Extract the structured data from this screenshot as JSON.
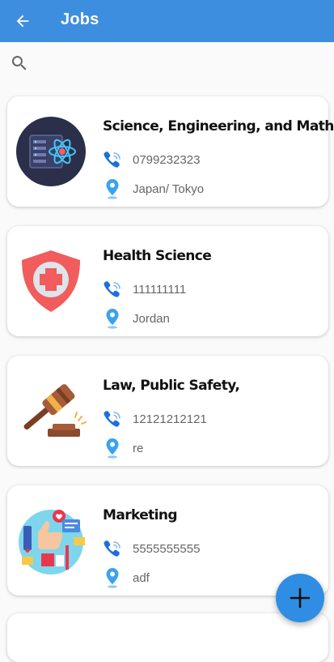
{
  "appbar": {
    "title": "Jobs",
    "back_icon": "arrow-left-icon",
    "color": "#3e8ee0"
  },
  "search": {
    "icon": "search-icon",
    "value": "",
    "placeholder": ""
  },
  "jobs": [
    {
      "title": "Science, Engineering, and Math",
      "phone": "0799232323",
      "location": "Japan/ Tokyo",
      "icon": "science-atom-icon"
    },
    {
      "title": "Health Science",
      "phone": "111111111",
      "location": "Jordan",
      "icon": "medical-shield-icon"
    },
    {
      "title": "Law, Public Safety,",
      "phone": "12121212121",
      "location": "re",
      "icon": "gavel-icon"
    },
    {
      "title": "Marketing",
      "phone": "5555555555",
      "location": "adf",
      "icon": "marketing-icon"
    }
  ],
  "fab": {
    "icon": "plus-icon",
    "color": "#2f8ee3"
  },
  "colors": {
    "phone_icon": "#1e6fd9",
    "location_icon": "#3aa3f0"
  }
}
